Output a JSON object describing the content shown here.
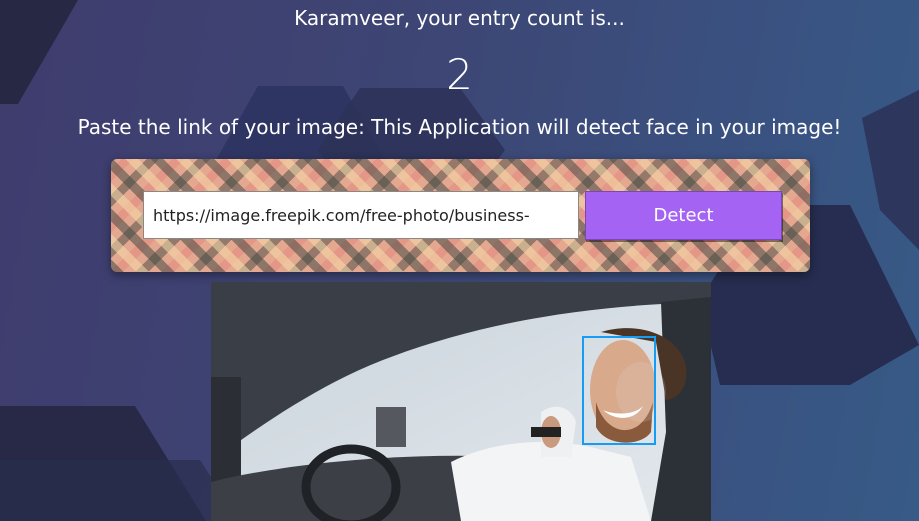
{
  "header": {
    "entry_text": "Karamveer, your entry count is...",
    "entry_count": "2"
  },
  "instructions": "Paste the link of your image: This Application will detect face in your image!",
  "form": {
    "url_value": "https://image.freepik.com/free-photo/business-",
    "button_label": "Detect"
  },
  "result": {
    "faces_detected": 1,
    "box_color": "#149df2"
  },
  "colors": {
    "button": "#a463f2",
    "background_left": "#3f3c6e",
    "background_right": "#375a86"
  }
}
